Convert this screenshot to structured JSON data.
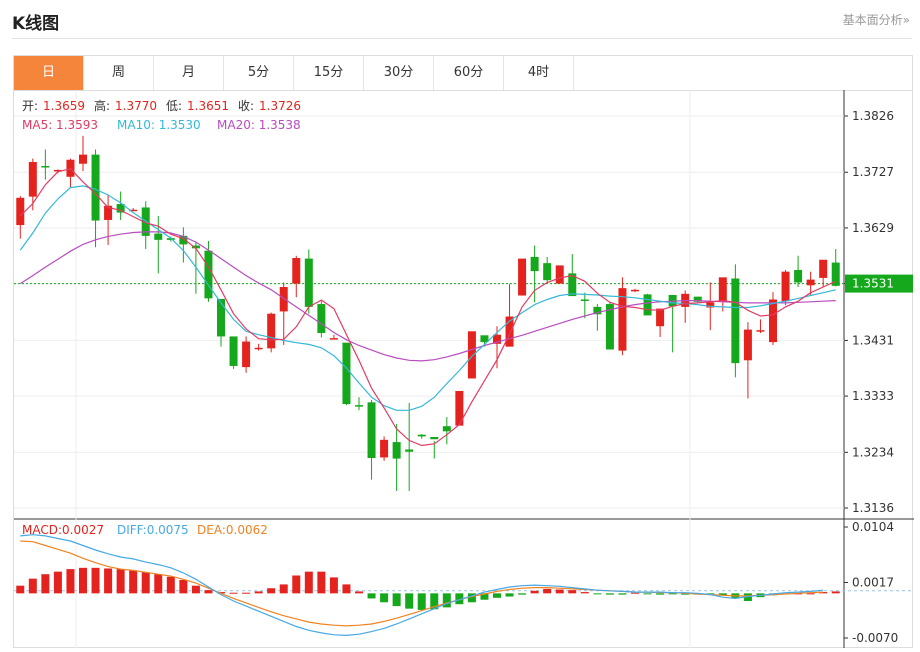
{
  "header": {
    "title": "K线图",
    "link": "基本面分析»"
  },
  "tabs": [
    "日",
    "周",
    "月",
    "5分",
    "15分",
    "30分",
    "60分",
    "4时"
  ],
  "active_tab": 0,
  "colors": {
    "up": "#e4231e",
    "down": "#15a81c",
    "ma5": "#e23b64",
    "ma10": "#34b8d8",
    "ma20": "#b84cc0",
    "diff": "#47a8e6",
    "dea": "#f08222",
    "active_tab": "#f4853b"
  },
  "ohlc_info": {
    "open_label": "开:",
    "open": "1.3659",
    "high_label": "高:",
    "high": "1.3770",
    "low_label": "低:",
    "low": "1.3651",
    "close_label": "收:",
    "close": "1.3726"
  },
  "ma_info": {
    "ma5": "MA5: 1.3593",
    "ma10": "MA10: 1.3530",
    "ma20": "MA20: 1.3538"
  },
  "macd_info": {
    "macd": "MACD:0.0027",
    "diff": "DIFF:0.0075",
    "dea": "DEA:0.0062"
  },
  "chart_data": [
    {
      "type": "candlestick",
      "y_ticks": [
        "1.3826",
        "1.3727",
        "1.3629",
        "1.3531",
        "1.3431",
        "1.3333",
        "1.3234",
        "1.3136"
      ],
      "ylim": [
        1.3136,
        1.3826
      ],
      "last_price": "1.3531",
      "candles": [
        [
          1.3634,
          1.3685,
          1.361,
          1.3682
        ],
        [
          1.3684,
          1.3751,
          1.366,
          1.3745
        ],
        [
          1.3738,
          1.3767,
          1.3714,
          1.3737
        ],
        [
          1.3731,
          1.3732,
          1.3725,
          1.3731
        ],
        [
          1.3719,
          1.3751,
          1.37,
          1.3749
        ],
        [
          1.3742,
          1.3791,
          1.3729,
          1.3758
        ],
        [
          1.3758,
          1.3767,
          1.3595,
          1.3642
        ],
        [
          1.3643,
          1.3688,
          1.3599,
          1.3668
        ],
        [
          1.3671,
          1.3693,
          1.3643,
          1.3656
        ],
        [
          1.3659,
          1.3664,
          1.3659,
          1.3661
        ],
        [
          1.3665,
          1.3676,
          1.3592,
          1.3615
        ],
        [
          1.3619,
          1.365,
          1.3549,
          1.3608
        ],
        [
          1.3611,
          1.3614,
          1.3605,
          1.3608
        ],
        [
          1.3615,
          1.363,
          1.3568,
          1.36
        ],
        [
          1.3598,
          1.3605,
          1.3513,
          1.3593
        ],
        [
          1.3589,
          1.3606,
          1.3499,
          1.3505
        ],
        [
          1.3504,
          1.3502,
          1.342,
          1.3438
        ],
        [
          1.3438,
          1.3436,
          1.3381,
          1.3386
        ],
        [
          1.3384,
          1.3438,
          1.3374,
          1.3429
        ],
        [
          1.3418,
          1.3425,
          1.3413,
          1.3418
        ],
        [
          1.3417,
          1.348,
          1.341,
          1.3478
        ],
        [
          1.3482,
          1.3533,
          1.3423,
          1.3525
        ],
        [
          1.3531,
          1.358,
          1.3507,
          1.3576
        ],
        [
          1.3575,
          1.3591,
          1.3478,
          1.349
        ],
        [
          1.3495,
          1.35,
          1.3436,
          1.3444
        ],
        [
          1.3435,
          1.3441,
          1.3434,
          1.3435
        ],
        [
          1.3427,
          1.3423,
          1.3317,
          1.3319
        ],
        [
          1.3317,
          1.3331,
          1.3308,
          1.3315
        ],
        [
          1.3322,
          1.3326,
          1.3186,
          1.3224
        ],
        [
          1.3225,
          1.3262,
          1.3219,
          1.3256
        ],
        [
          1.3252,
          1.3284,
          1.3166,
          1.3223
        ],
        [
          1.3239,
          1.3321,
          1.3166,
          1.3235
        ],
        [
          1.3265,
          1.3266,
          1.3258,
          1.3262
        ],
        [
          1.3261,
          1.3254,
          1.3223,
          1.3257
        ],
        [
          1.328,
          1.3296,
          1.3248,
          1.3271
        ],
        [
          1.3281,
          1.3337,
          1.3283,
          1.3342
        ],
        [
          1.3364,
          1.3447,
          1.3368,
          1.3447
        ],
        [
          1.344,
          1.3437,
          1.342,
          1.3428
        ],
        [
          1.3425,
          1.3456,
          1.3382,
          1.3441
        ],
        [
          1.342,
          1.353,
          1.3431,
          1.3473
        ],
        [
          1.351,
          1.3562,
          1.351,
          1.3575
        ],
        [
          1.3578,
          1.3598,
          1.3498,
          1.3553
        ],
        [
          1.3567,
          1.3578,
          1.3531,
          1.3537
        ],
        [
          1.3531,
          1.3557,
          1.3531,
          1.3563
        ],
        [
          1.3549,
          1.3583,
          1.3526,
          1.3509
        ],
        [
          1.3503,
          1.3515,
          1.347,
          1.3502
        ],
        [
          1.349,
          1.3495,
          1.3448,
          1.3477
        ],
        [
          1.3495,
          1.3497,
          1.3421,
          1.3415
        ],
        [
          1.3413,
          1.3542,
          1.3405,
          1.3523
        ],
        [
          1.352,
          1.3522,
          1.3516,
          1.352
        ],
        [
          1.3512,
          1.3513,
          1.3479,
          1.3475
        ],
        [
          1.3456,
          1.3485,
          1.3437,
          1.3487
        ],
        [
          1.3511,
          1.351,
          1.341,
          1.3491
        ],
        [
          1.349,
          1.3519,
          1.3462,
          1.3513
        ],
        [
          1.3508,
          1.3508,
          1.3497,
          1.3499
        ],
        [
          1.3489,
          1.3533,
          1.3449,
          1.3498
        ],
        [
          1.3501,
          1.3535,
          1.3482,
          1.3542
        ],
        [
          1.354,
          1.3565,
          1.3366,
          1.3391
        ],
        [
          1.3396,
          1.3463,
          1.3329,
          1.345
        ],
        [
          1.3448,
          1.3468,
          1.3444,
          1.3449
        ],
        [
          1.3428,
          1.3516,
          1.3423,
          1.3503
        ],
        [
          1.35,
          1.3555,
          1.3493,
          1.3552
        ],
        [
          1.3555,
          1.358,
          1.3525,
          1.3533
        ],
        [
          1.3528,
          1.3552,
          1.351,
          1.3538
        ],
        [
          1.3541,
          1.357,
          1.3525,
          1.3573
        ],
        [
          1.3568,
          1.3592,
          1.3526,
          1.3527
        ]
      ],
      "ma5": [
        1.365,
        1.3672,
        1.3705,
        1.3728,
        1.3733,
        1.371,
        1.3689,
        1.3665,
        1.366,
        1.3649,
        1.3638,
        1.3632,
        1.3618,
        1.361,
        1.3593,
        1.356,
        1.352,
        1.3478,
        1.3451,
        1.3434,
        1.3432,
        1.3433,
        1.3455,
        1.349,
        1.3502,
        1.3487,
        1.3441,
        1.3396,
        1.3347,
        1.3312,
        1.3275,
        1.3255,
        1.3246,
        1.3249,
        1.3265,
        1.3283,
        1.3323,
        1.336,
        1.3397,
        1.3442,
        1.349,
        1.3519,
        1.3533,
        1.3541,
        1.3545,
        1.3535,
        1.3514,
        1.3498,
        1.3491,
        1.3489,
        1.3485,
        1.3484,
        1.3491,
        1.3496,
        1.3497,
        1.3499,
        1.3501,
        1.3498,
        1.3484,
        1.3474,
        1.3476,
        1.349,
        1.35,
        1.3515,
        1.3525,
        1.3535
      ],
      "ma10": [
        1.359,
        1.362,
        1.3655,
        1.368,
        1.37,
        1.3703,
        1.3697,
        1.3687,
        1.3673,
        1.3656,
        1.3641,
        1.3626,
        1.3611,
        1.3589,
        1.356,
        1.3528,
        1.3497,
        1.3468,
        1.3447,
        1.3441,
        1.3436,
        1.3431,
        1.3427,
        1.3424,
        1.3418,
        1.3404,
        1.3382,
        1.3356,
        1.3331,
        1.3316,
        1.3308,
        1.3308,
        1.3315,
        1.3331,
        1.3355,
        1.3378,
        1.3403,
        1.3424,
        1.3445,
        1.3465,
        1.348,
        1.3494,
        1.3503,
        1.351,
        1.3513,
        1.3512,
        1.3511,
        1.3509,
        1.3508,
        1.3506,
        1.3503,
        1.35,
        1.3497,
        1.3496,
        1.3494,
        1.3491,
        1.349,
        1.3489,
        1.3489,
        1.3492,
        1.3496,
        1.35,
        1.3505,
        1.351,
        1.3515,
        1.352
      ],
      "ma20": [
        1.3531,
        1.3545,
        1.356,
        1.3574,
        1.3588,
        1.36,
        1.3608,
        1.3614,
        1.3618,
        1.3621,
        1.3622,
        1.3622,
        1.362,
        1.3614,
        1.3604,
        1.359,
        1.3575,
        1.356,
        1.3545,
        1.3532,
        1.352,
        1.3505,
        1.349,
        1.3475,
        1.346,
        1.3445,
        1.3432,
        1.3422,
        1.3414,
        1.3406,
        1.34,
        1.3396,
        1.3395,
        1.3397,
        1.3402,
        1.3408,
        1.3415,
        1.3422,
        1.3428,
        1.3434,
        1.344,
        1.3447,
        1.3454,
        1.3461,
        1.3468,
        1.3474,
        1.348,
        1.3485,
        1.349,
        1.3494,
        1.3497,
        1.3499,
        1.35,
        1.3501,
        1.3501,
        1.35,
        1.3499,
        1.3498,
        1.3497,
        1.3497,
        1.3497,
        1.3497,
        1.3498,
        1.3499,
        1.35,
        1.3501
      ]
    },
    {
      "type": "macd",
      "y_ticks": [
        "0.0104",
        "0.0017",
        "-0.0070"
      ],
      "ylim": [
        -0.007,
        0.0104
      ],
      "macd": [
        0.0012,
        0.0023,
        0.003,
        0.0034,
        0.0038,
        0.004,
        0.004,
        0.0039,
        0.0038,
        0.0036,
        0.0033,
        0.003,
        0.0026,
        0.0021,
        0.0012,
        0.0005,
        0.0002,
        0.0001,
        0.0001,
        0.0003,
        0.0008,
        0.0014,
        0.0028,
        0.0034,
        0.0034,
        0.0025,
        0.0014,
        0.0003,
        -0.0008,
        -0.0014,
        -0.002,
        -0.0024,
        -0.0026,
        -0.0025,
        -0.0022,
        -0.0017,
        -0.0014,
        -0.001,
        -0.0007,
        -0.0005,
        -0.0002,
        0.0004,
        0.0007,
        0.0006,
        0.0005,
        0.0002,
        -0.0001,
        -0.0002,
        -0.0002,
        0.0001,
        -0.0001,
        -0.0002,
        -0.0001,
        -0.0002,
        -0.0002,
        -0.0002,
        -0.0003,
        -0.0008,
        -0.0012,
        -0.0006,
        -0.0003,
        -0.0001,
        0.0,
        0.0,
        0.0002,
        0.0003
      ],
      "diff": [
        0.009,
        0.0092,
        0.009,
        0.0086,
        0.0082,
        0.0075,
        0.0068,
        0.0062,
        0.0057,
        0.0054,
        0.0049,
        0.0045,
        0.004,
        0.0032,
        0.0022,
        0.001,
        -0.0002,
        -0.0012,
        -0.002,
        -0.0028,
        -0.0036,
        -0.0044,
        -0.0052,
        -0.0058,
        -0.0062,
        -0.0065,
        -0.0066,
        -0.0064,
        -0.006,
        -0.0055,
        -0.0048,
        -0.004,
        -0.0032,
        -0.0024,
        -0.0016,
        -0.001,
        -0.0004,
        0.0002,
        0.0006,
        0.001,
        0.0012,
        0.0013,
        0.0012,
        0.0011,
        0.0009,
        0.0007,
        0.0005,
        0.0004,
        0.0003,
        0.0002,
        0.0002,
        0.0002,
        0.0001,
        0.0001,
        0.0,
        -0.0002,
        -0.0006,
        -0.0008,
        -0.0005,
        -0.0003,
        -0.0001,
        0.0001,
        0.0002,
        0.0003,
        0.0005
      ],
      "dea": [
        0.0082,
        0.0081,
        0.0075,
        0.0069,
        0.0063,
        0.0055,
        0.0048,
        0.0042,
        0.0038,
        0.0036,
        0.0033,
        0.003,
        0.0027,
        0.0022,
        0.0016,
        0.0008,
        0.0,
        -0.0008,
        -0.0015,
        -0.0022,
        -0.0029,
        -0.0035,
        -0.004,
        -0.0045,
        -0.0048,
        -0.005,
        -0.0051,
        -0.005,
        -0.0048,
        -0.0044,
        -0.0039,
        -0.0033,
        -0.0027,
        -0.0021,
        -0.0015,
        -0.001,
        -0.0005,
        -0.0001,
        0.0003,
        0.0006,
        0.0008,
        0.0009,
        0.0009,
        0.0008,
        0.0007,
        0.0006,
        0.0005,
        0.0004,
        0.0003,
        0.0002,
        0.0002,
        0.0001,
        0.0001,
        0.0,
        -0.0001,
        -0.0002,
        -0.0003,
        -0.0004,
        -0.0004,
        -0.0003,
        -0.0002,
        -0.0001,
        0.0,
        0.0001,
        0.0002
      ]
    }
  ]
}
